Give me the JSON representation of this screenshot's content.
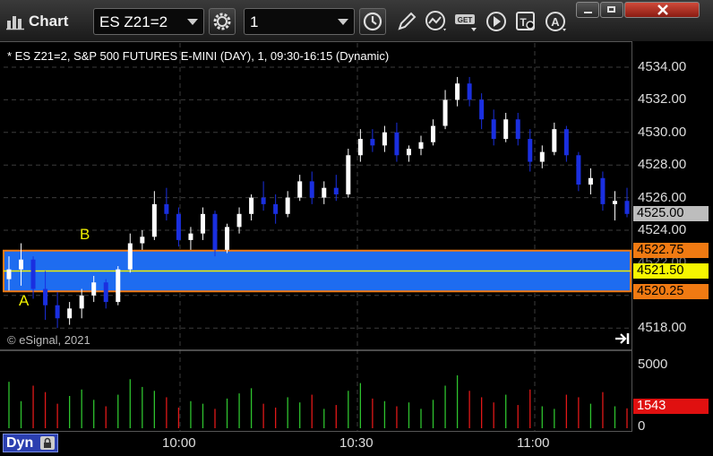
{
  "window": {
    "app_title": "Chart",
    "symbol": "ES Z21=2",
    "interval": "1"
  },
  "chart": {
    "header": "* ES Z21=2, S&P 500 FUTURES E-MINI (DAY), 1, 09:30-16:15 (Dynamic)",
    "copyright": "© eSignal, 2021",
    "marker_a": "A",
    "marker_b": "B",
    "colors": {
      "up": "#ffffff",
      "down": "#1a2fe0",
      "zone_fill": "#1e6cf0",
      "zone_border": "#f07a12",
      "mid_line": "#f0f000"
    },
    "price_labels": [
      "4534.00",
      "4532.00",
      "4530.00",
      "4528.00",
      "4526.00",
      "4524.00",
      "4522.00",
      "4520.00",
      "4518.00"
    ],
    "last_price": "4525.00",
    "zone_top": "4522.75",
    "zone_mid": "4521.50",
    "zone_bottom": "4520.25",
    "time_labels": [
      "10:00",
      "10:30",
      "11:00"
    ]
  },
  "volume": {
    "labels": [
      "5000",
      "0"
    ],
    "last_volume": "1543"
  },
  "footer": {
    "dyn_label": "Dyn"
  },
  "chart_data": {
    "type": "candlestick",
    "series": [
      {
        "name": "price",
        "values": [
          [
            4521.0,
            4522.4,
            4520.3,
            4521.6
          ],
          [
            4521.6,
            4523.2,
            4520.6,
            4522.2
          ],
          [
            4522.2,
            4522.4,
            4519.8,
            4520.4
          ],
          [
            4520.4,
            4521.5,
            4518.5,
            4519.4
          ],
          [
            4519.4,
            4520.2,
            4518.0,
            4518.6
          ],
          [
            4518.6,
            4519.6,
            4518.2,
            4519.2
          ],
          [
            4519.2,
            4520.4,
            4518.6,
            4520.0
          ],
          [
            4520.0,
            4521.2,
            4519.6,
            4520.8
          ],
          [
            4520.8,
            4521.0,
            4519.2,
            4519.6
          ],
          [
            4519.6,
            4521.8,
            4519.4,
            4521.6
          ],
          [
            4521.6,
            4523.8,
            4521.4,
            4523.2
          ],
          [
            4523.2,
            4524.0,
            4522.8,
            4523.6
          ],
          [
            4523.6,
            4526.4,
            4523.4,
            4525.6
          ],
          [
            4525.6,
            4526.6,
            4524.6,
            4525.0
          ],
          [
            4525.0,
            4525.4,
            4523.0,
            4523.4
          ],
          [
            4523.4,
            4524.2,
            4522.8,
            4523.8
          ],
          [
            4523.8,
            4525.4,
            4523.4,
            4525.0
          ],
          [
            4525.0,
            4525.2,
            4522.4,
            4522.8
          ],
          [
            4522.8,
            4524.4,
            4522.6,
            4524.2
          ],
          [
            4524.2,
            4525.4,
            4523.8,
            4525.0
          ],
          [
            4525.0,
            4526.2,
            4524.6,
            4526.0
          ],
          [
            4526.0,
            4527.0,
            4525.2,
            4525.6
          ],
          [
            4525.6,
            4526.2,
            4524.4,
            4525.0
          ],
          [
            4525.0,
            4526.4,
            4524.8,
            4526.0
          ],
          [
            4526.0,
            4527.4,
            4525.8,
            4527.0
          ],
          [
            4527.0,
            4527.6,
            4525.6,
            4526.0
          ],
          [
            4526.0,
            4527.0,
            4525.6,
            4526.6
          ],
          [
            4526.6,
            4527.4,
            4525.8,
            4526.2
          ],
          [
            4526.2,
            4529.0,
            4526.0,
            4528.6
          ],
          [
            4528.6,
            4530.2,
            4528.2,
            4529.6
          ],
          [
            4529.6,
            4530.2,
            4528.8,
            4529.2
          ],
          [
            4529.2,
            4530.4,
            4528.8,
            4530.0
          ],
          [
            4530.0,
            4530.6,
            4528.2,
            4528.6
          ],
          [
            4528.6,
            4529.2,
            4528.2,
            4529.0
          ],
          [
            4529.0,
            4529.8,
            4528.6,
            4529.4
          ],
          [
            4529.4,
            4530.8,
            4529.2,
            4530.4
          ],
          [
            4530.4,
            4532.6,
            4530.2,
            4532.0
          ],
          [
            4532.0,
            4533.4,
            4531.6,
            4533.0
          ],
          [
            4533.0,
            4533.4,
            4531.6,
            4532.0
          ],
          [
            4532.0,
            4532.4,
            4530.2,
            4530.8
          ],
          [
            4530.8,
            4531.4,
            4529.2,
            4529.6
          ],
          [
            4529.6,
            4531.2,
            4529.4,
            4530.8
          ],
          [
            4530.8,
            4531.2,
            4529.2,
            4529.6
          ],
          [
            4529.6,
            4530.2,
            4527.6,
            4528.2
          ],
          [
            4528.2,
            4529.2,
            4527.8,
            4528.8
          ],
          [
            4528.8,
            4530.6,
            4528.6,
            4530.2
          ],
          [
            4530.2,
            4530.4,
            4528.2,
            4528.6
          ],
          [
            4528.6,
            4528.8,
            4526.4,
            4526.8
          ],
          [
            4526.8,
            4527.8,
            4526.2,
            4527.2
          ],
          [
            4527.2,
            4527.6,
            4525.2,
            4525.6
          ],
          [
            4525.6,
            4526.4,
            4524.6,
            4525.8
          ],
          [
            4525.8,
            4526.6,
            4524.8,
            4525.0
          ]
        ]
      }
    ],
    "volumes": [
      3600,
      2100,
      3300,
      2800,
      1900,
      2500,
      3000,
      2200,
      1700,
      2600,
      3800,
      3200,
      2900,
      2400,
      1600,
      2100,
      1900,
      1500,
      2300,
      2700,
      3100,
      1900,
      1600,
      2400,
      2000,
      2600,
      1500,
      1800,
      2900,
      3500,
      2300,
      2100,
      1700,
      2000,
      1500,
      2200,
      3300,
      4100,
      2900,
      2400,
      2000,
      2600,
      1800,
      3000,
      1700,
      1500,
      2600,
      2400,
      1900,
      2800,
      1700,
      1543
    ],
    "ylim": [
      4517,
      4535.5
    ]
  }
}
